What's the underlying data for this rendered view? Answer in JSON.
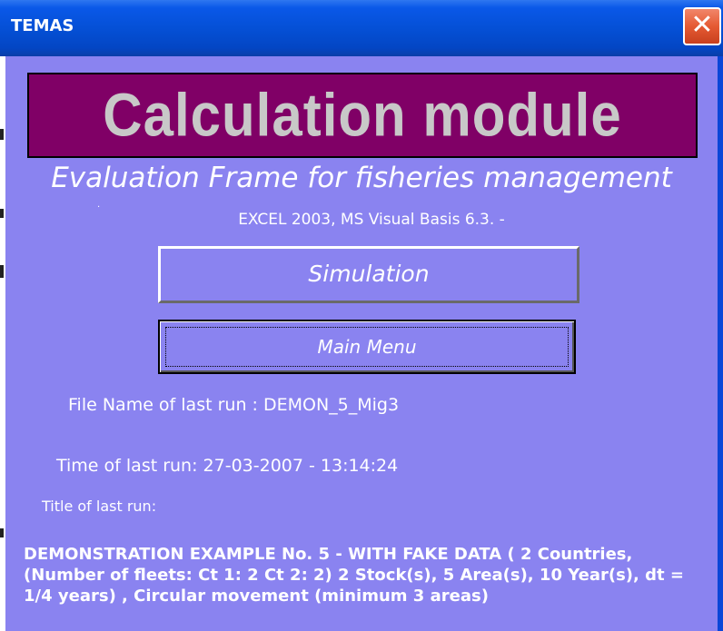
{
  "window": {
    "title": "TEMAS",
    "close_glyph": "✕"
  },
  "banner": {
    "text": "Calculation  module"
  },
  "subtitle": "Evaluation Frame for fisheries management",
  "version": "EXCEL 2003, MS Visual Basis 6.3. -",
  "buttons": {
    "simulation": "Simulation",
    "main_menu": "Main Menu"
  },
  "info": {
    "file_name": "File Name of last run : DEMON_5_Mig3",
    "time": "Time of last run: 27-03-2007 - 13:14:24",
    "title_label": "Title of last run:",
    "description": "DEMONSTRATION EXAMPLE No. 5 -  WITH FAKE DATA (  2  Countries, (Number of fleets:  Ct 1:  2  Ct 2:  2)  2 Stock(s),  5 Area(s),  10 Year(s),    dt = 1/4 years) , Circular movement (minimum 3 areas)"
  },
  "colors": {
    "titlebar": "#0550d6",
    "client_background": "#8a83f0",
    "banner_background": "#800066",
    "banner_text": "#c8c8c8",
    "text": "#ffffff",
    "close_button": "#e55a33"
  },
  "icons": {
    "close": "close-icon"
  }
}
